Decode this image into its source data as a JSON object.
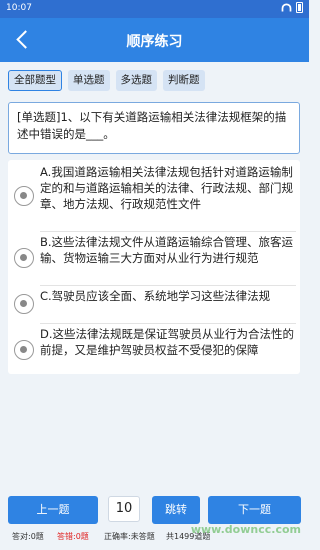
{
  "status": {
    "time": "10:07"
  },
  "header": {
    "title": "顺序练习"
  },
  "tabs": [
    {
      "label": "全部题型",
      "active": true
    },
    {
      "label": "单选题"
    },
    {
      "label": "多选题"
    },
    {
      "label": "判断题"
    }
  ],
  "question": {
    "text": "[单选题]1、以下有关道路运输相关法律法规框架的描述中错误的是___。"
  },
  "options": [
    {
      "text": "A.我国道路运输相关法律法规包括针对道路运输制定的和与道路运输相关的法律、行政法规、部门规章、地方法规、行政规范性文件"
    },
    {
      "text": "B.这些法律法规文件从道路运输综合管理、旅客运输、货物运输三大方面对从业行为进行规范"
    },
    {
      "text": "C.驾驶员应该全面、系统地学习这些法律法规"
    },
    {
      "text": "D.这些法律法规既是保证驾驶员从业行为合法性的前提，又是维护驾驶员权益不受侵犯的保障"
    }
  ],
  "footer": {
    "prev_label": "上一题",
    "page": "10",
    "jump_label": "跳转",
    "next_label": "下一题",
    "stats": {
      "correct": "答对:0题",
      "wrong": "答错:0题",
      "accuracy": "正确率:未答题",
      "total": "共1499道题"
    },
    "watermark": "www.downcc.com"
  },
  "colors": {
    "accent": "#2f83e3",
    "wrong": "#e02020"
  }
}
